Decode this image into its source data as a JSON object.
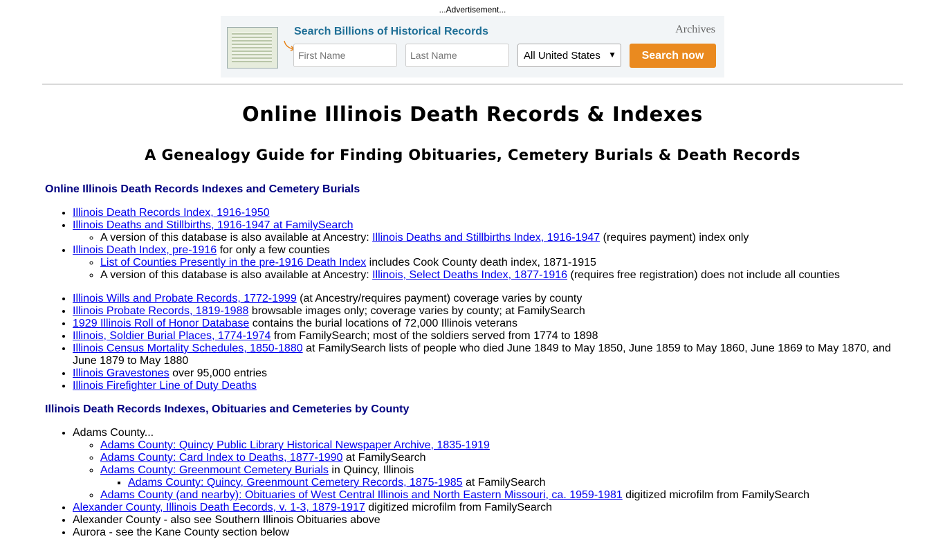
{
  "ad": {
    "caption": "...Advertisement...",
    "headline": "Search Billions of Historical Records",
    "brand": "Archives",
    "first_placeholder": "First Name",
    "last_placeholder": "Last Name",
    "location": "All United States",
    "button": "Search now"
  },
  "title": "Online Illinois Death Records & Indexes",
  "subtitle": "A Genealogy Guide for Finding Obituaries, Cemetery Burials & Death Records",
  "sec1": {
    "title": "Online Illinois Death Records Indexes and Cemetery Burials",
    "i1": "Illinois Death Records Index, 1916-1950",
    "i2": "Illinois Deaths and Stillbirths, 1916-1947 at FamilySearch",
    "i2a_text": "A version of this database is also available at Ancestry: ",
    "i2a_link": "Illinois Deaths and Stillbirths Index, 1916-1947",
    "i2a_after": " (requires payment) index only",
    "i3_link": "Illinois Death Index, pre-1916",
    "i3_after": " for only a few counties",
    "i3a_link": "List of Counties Presently in the pre-1916 Death Index",
    "i3a_after": " includes Cook County death index, 1871-1915",
    "i3b_text": "A version of this database is also available at Ancestry: ",
    "i3b_link": "Illinois, Select Deaths Index, 1877-1916",
    "i3b_after": " (requires free registration) does not include all counties",
    "i4_link": "Illinois Wills and Probate Records, 1772-1999",
    "i4_after": " (at Ancestry/requires payment) coverage varies by county",
    "i5_link": "Illinois Probate Records, 1819-1988",
    "i5_after": " browsable images only; coverage varies by county; at FamilySearch",
    "i6_link": "1929 Illinois Roll of Honor Database",
    "i6_after": " contains the burial locations of 72,000 Illinois veterans",
    "i7_link": "Illinois, Soldier Burial Places, 1774-1974",
    "i7_after": " from FamilySearch; most of the soldiers served from 1774 to 1898",
    "i8_link": "Illinois Census Mortality Schedules, 1850-1880",
    "i8_after": " at FamilySearch lists of people who died June 1849 to May 1850, June 1859 to May 1860, June 1869 to May 1870, and June 1879 to May 1880",
    "i9_link": "Illinois Gravestones",
    "i9_after": " over 95,000 entries",
    "i10_link": "Illinois Firefighter Line of Duty Deaths"
  },
  "sec2": {
    "title": "Illinois Death Records Indexes, Obituaries and Cemeteries by County",
    "adams": "Adams County...",
    "a1_link": "Adams County: Quincy Public Library Historical Newspaper Archive, 1835-1919",
    "a2_link": "Adams County: Card Index to Deaths, 1877-1990",
    "a2_after": " at FamilySearch",
    "a3_link": "Adams County: Greenmount Cemetery Burials",
    "a3_after": " in Quincy, Illinois",
    "a3a_link": "Adams County: Quincy, Greenmount Cemetery Records, 1875-1985",
    "a3a_after": " at FamilySearch",
    "a4_link": "Adams County (and nearby): Obituaries of West Central Illinois and North Eastern Missouri, ca. 1959-1981",
    "a4_after": " digitized microfilm from FamilySearch",
    "alex_link": "Alexander County, Illinois Death Eecords, v. 1-3, 1879-1917",
    "alex_after": " digitized microfilm from FamilySearch",
    "alex2": "Alexander County - also see Southern Illinois Obituaries above",
    "aurora": "Aurora - see the Kane County section below"
  }
}
